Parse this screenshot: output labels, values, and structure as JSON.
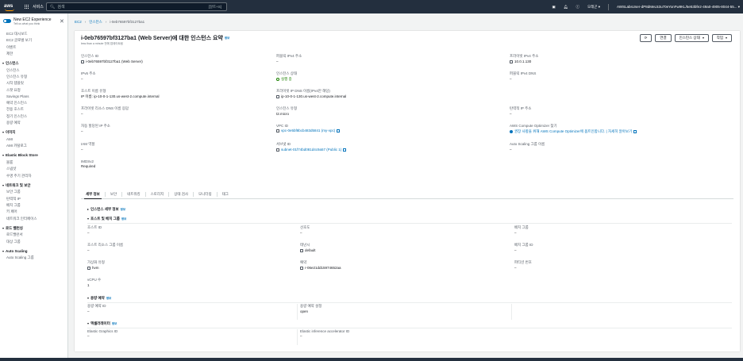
{
  "topnav": {
    "services_label": "서비스",
    "search_placeholder": "검색",
    "search_shortcut": "[알트+S]",
    "region": "오레곤",
    "account": "AWSLabsUser-dP8dMeL53u70eYonFw9KL/5e53bfe2-49a0-4905-8044-55..."
  },
  "sidebar": {
    "experience_title": "New EC2 Experience",
    "experience_sub": "Tell us what you think",
    "top_items": [
      "EC2 대시보드",
      "EC2 글로벌 보기",
      "이벤트",
      "제한"
    ],
    "groups": [
      {
        "title": "인스턴스",
        "items": [
          "인스턴스",
          "인스턴스 유형",
          "시작 템플릿",
          "스팟 요청",
          "Savings Plans",
          "예약 인스턴스",
          "전용 호스트",
          "정기 인스턴스",
          "용량 예약"
        ]
      },
      {
        "title": "이미지",
        "items": [
          "AMI",
          "AMI 카탈로그"
        ]
      },
      {
        "title": "Elastic Block Store",
        "items": [
          "볼륨",
          "스냅샷",
          "수명 주기 관리자"
        ]
      },
      {
        "title": "네트워크 및 보안",
        "items": [
          "보안 그룹",
          "탄력적 IP",
          "배치 그룹",
          "키 페어",
          "네트워크 인터페이스"
        ]
      },
      {
        "title": "로드 밸런싱",
        "items": [
          "로드밸런서",
          "대상 그룹"
        ]
      },
      {
        "title": "Auto Scaling",
        "items": [
          "Auto Scaling 그룹"
        ]
      }
    ]
  },
  "breadcrumb": {
    "root": "EC2",
    "level1": "인스턴스",
    "current": "i-0eb76597bf3127ba1"
  },
  "panel": {
    "title": "i-0eb76597bf3127ba1 (Web Server)에 대한 인스턴스 요약",
    "info": "정보",
    "updated": "less than a minute 전에 업데이트됨",
    "buttons": {
      "refresh": "⟳",
      "connect": "연결",
      "state": "인스턴스 상태",
      "actions": "작업"
    }
  },
  "summary": {
    "instance_id": {
      "label": "인스턴스 ID",
      "value": "i-0eb76597bf3127ba1 (Web Server)"
    },
    "ipv6": {
      "label": "IPv6 주소",
      "value": "–"
    },
    "hostname_type": {
      "label": "호스트 이름 유형",
      "value": "IP 이름: ip-10-0-1-130.us-west-2.compute.internal"
    },
    "private_dns_name": {
      "label": "프라이빗 리소스 DNS 이름 응답",
      "value": "–"
    },
    "auto_ip": {
      "label": "자동 할당된 IP 주소",
      "value": "–"
    },
    "iam_role": {
      "label": "IAM 역할",
      "value": "–"
    },
    "imdsv2": {
      "label": "IMDSv2",
      "value": "Required"
    },
    "public_ipv4": {
      "label": "퍼블릭 IPv4 주소",
      "value": "–"
    },
    "state": {
      "label": "인스턴스 상태",
      "value": "실행 중"
    },
    "private_ip_dns": {
      "label": "프라이빗 IP DNS 이름(IPv4만 해당)",
      "value": "ip-10-0-1-130.us-west-2.compute.internal"
    },
    "instance_type": {
      "label": "인스턴스 유형",
      "value": "t2.micro"
    },
    "vpc_id": {
      "label": "VPC ID",
      "value": "vpc-0e5bf8bcb483d5841 (my-vpc)"
    },
    "subnet_id": {
      "label": "서브넷 ID",
      "value": "subnet-01f74bd081d4c9a57 (Public 1)"
    },
    "private_ipv4": {
      "label": "프라이빗 IPv4 주소",
      "value": "10.0.1.130"
    },
    "public_ipv4_dns": {
      "label": "퍼블릭 IPv4 DNS",
      "value": "–"
    },
    "elastic_ip": {
      "label": "탄력적 IP 주소",
      "value": "–"
    },
    "optimizer": {
      "label": "AWS Compute Optimizer 찾기",
      "value": "권장 사항을 위해 AWS Compute Optimizer에 옵트인합니다. | 자세히 알아보기"
    },
    "asg_name": {
      "label": "Auto Scaling 그룹 이름",
      "value": "–"
    }
  },
  "tabs": [
    "세부 정보",
    "보안",
    "네트워킹",
    "스토리지",
    "상태 검사",
    "모니터링",
    "태그"
  ],
  "details": {
    "instance_details_title": "인스턴스 세부 정보",
    "host_group_title": "호스트 및 배치 그룹",
    "info": "정보",
    "host_id": {
      "label": "호스트 ID",
      "value": "–"
    },
    "affinity": {
      "label": "선호도",
      "value": "–"
    },
    "placement_group": {
      "label": "배치 그룹",
      "value": "–"
    },
    "host_resource_group": {
      "label": "호스트 리소스 그룹 이름",
      "value": "–"
    },
    "tenancy": {
      "label": "테넌시",
      "value": "default"
    },
    "placement_group_id": {
      "label": "배치 그룹 ID",
      "value": "–"
    },
    "virtualization": {
      "label": "가상화 유형",
      "value": "hvm"
    },
    "reservation": {
      "label": "예약",
      "value": "r-06e21dd15974652aa"
    },
    "partition": {
      "label": "파티션 번호",
      "value": "–"
    },
    "vcpu": {
      "label": "vCPU 수",
      "value": "1"
    },
    "capacity_title": "용량 예약",
    "capacity_id": {
      "label": "용량 예약 ID",
      "value": "–"
    },
    "capacity_setting": {
      "label": "용량 예약 설정",
      "value": "open"
    },
    "accelerator_title": "액셀러레이터",
    "gpu_id": {
      "label": "Elastic Graphics ID",
      "value": "–"
    },
    "inference_id": {
      "label": "Elastic inference accelerator ID",
      "value": "–"
    }
  }
}
